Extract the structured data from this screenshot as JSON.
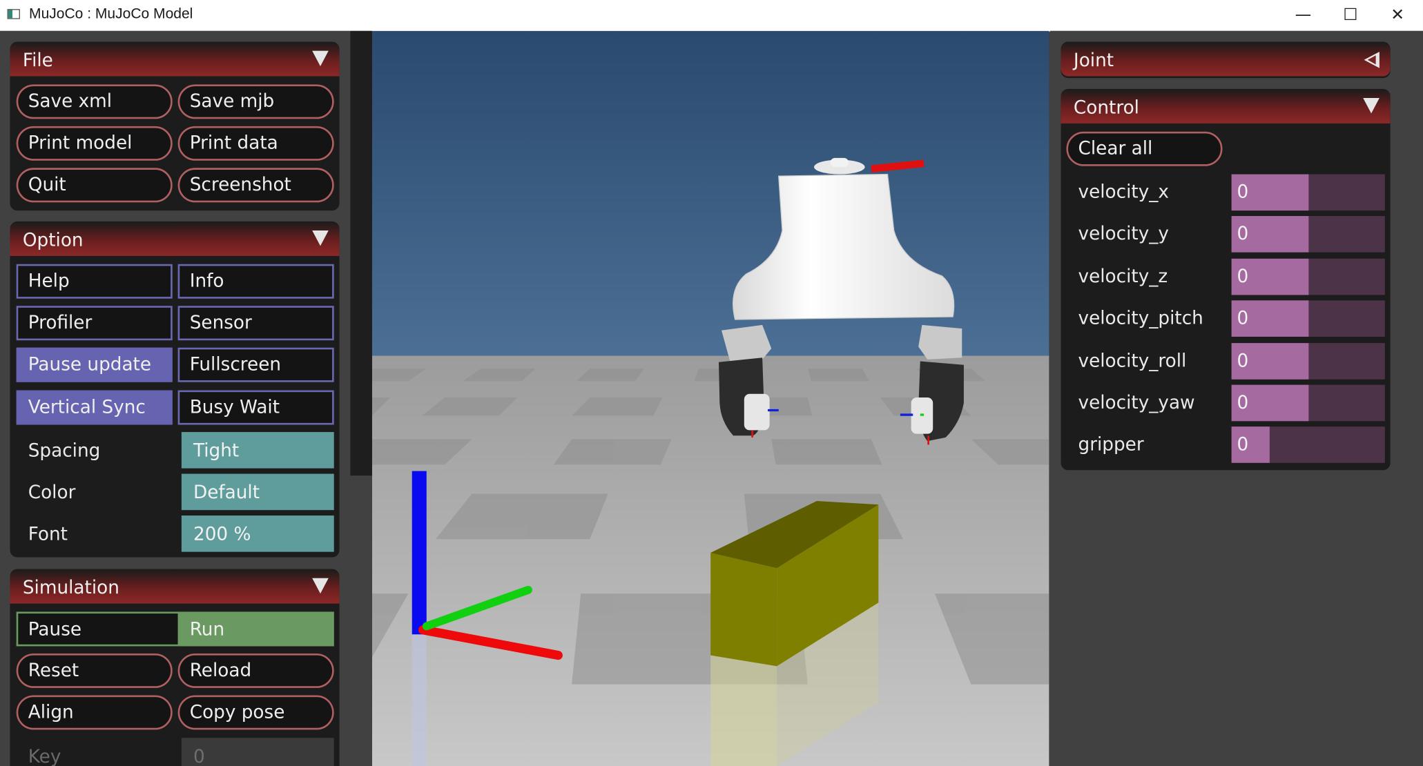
{
  "window": {
    "title": "MuJoCo : MuJoCo Model",
    "controls": {
      "minimize": "—",
      "maximize": "☐",
      "close": "✕"
    }
  },
  "left": {
    "file": {
      "header": "File",
      "buttons": [
        "Save xml",
        "Save mjb",
        "Print model",
        "Print data",
        "Quit",
        "Screenshot"
      ]
    },
    "option": {
      "header": "Option",
      "toggles": [
        {
          "label": "Help",
          "on": false
        },
        {
          "label": "Info",
          "on": false
        },
        {
          "label": "Profiler",
          "on": false
        },
        {
          "label": "Sensor",
          "on": false
        },
        {
          "label": "Pause update",
          "on": true
        },
        {
          "label": "Fullscreen",
          "on": false
        },
        {
          "label": "Vertical Sync",
          "on": true
        },
        {
          "label": "Busy Wait",
          "on": false
        }
      ],
      "selects": [
        {
          "label": "Spacing",
          "value": "Tight"
        },
        {
          "label": "Color",
          "value": "Default"
        },
        {
          "label": "Font",
          "value": "200 %"
        }
      ]
    },
    "simulation": {
      "header": "Simulation",
      "pause": "Pause",
      "run": "Run",
      "buttons": [
        "Reset",
        "Reload",
        "Align",
        "Copy pose"
      ],
      "key_label": "Key",
      "key_value": "0"
    }
  },
  "right": {
    "joint": {
      "header": "Joint"
    },
    "control": {
      "header": "Control",
      "clear_all": "Clear all",
      "sliders": [
        {
          "label": "velocity_x",
          "value": "0",
          "fill": 0.5
        },
        {
          "label": "velocity_y",
          "value": "0",
          "fill": 0.5
        },
        {
          "label": "velocity_z",
          "value": "0",
          "fill": 0.5
        },
        {
          "label": "velocity_pitch",
          "value": "0",
          "fill": 0.5
        },
        {
          "label": "velocity_roll",
          "value": "0",
          "fill": 0.5
        },
        {
          "label": "velocity_yaw",
          "value": "0",
          "fill": 0.5
        },
        {
          "label": "gripper",
          "value": "0",
          "fill": 0.25
        }
      ]
    }
  },
  "colors": {
    "header_red": "#8c2828",
    "toggle_on": "#6664b0",
    "select_teal": "#5f9d9d",
    "run_green": "#6a9a62",
    "slider_fill": "#a56aa0",
    "slider_bg": "#4d3348",
    "sky": "#2c4d72",
    "box_yellow": "#7f7f00"
  }
}
